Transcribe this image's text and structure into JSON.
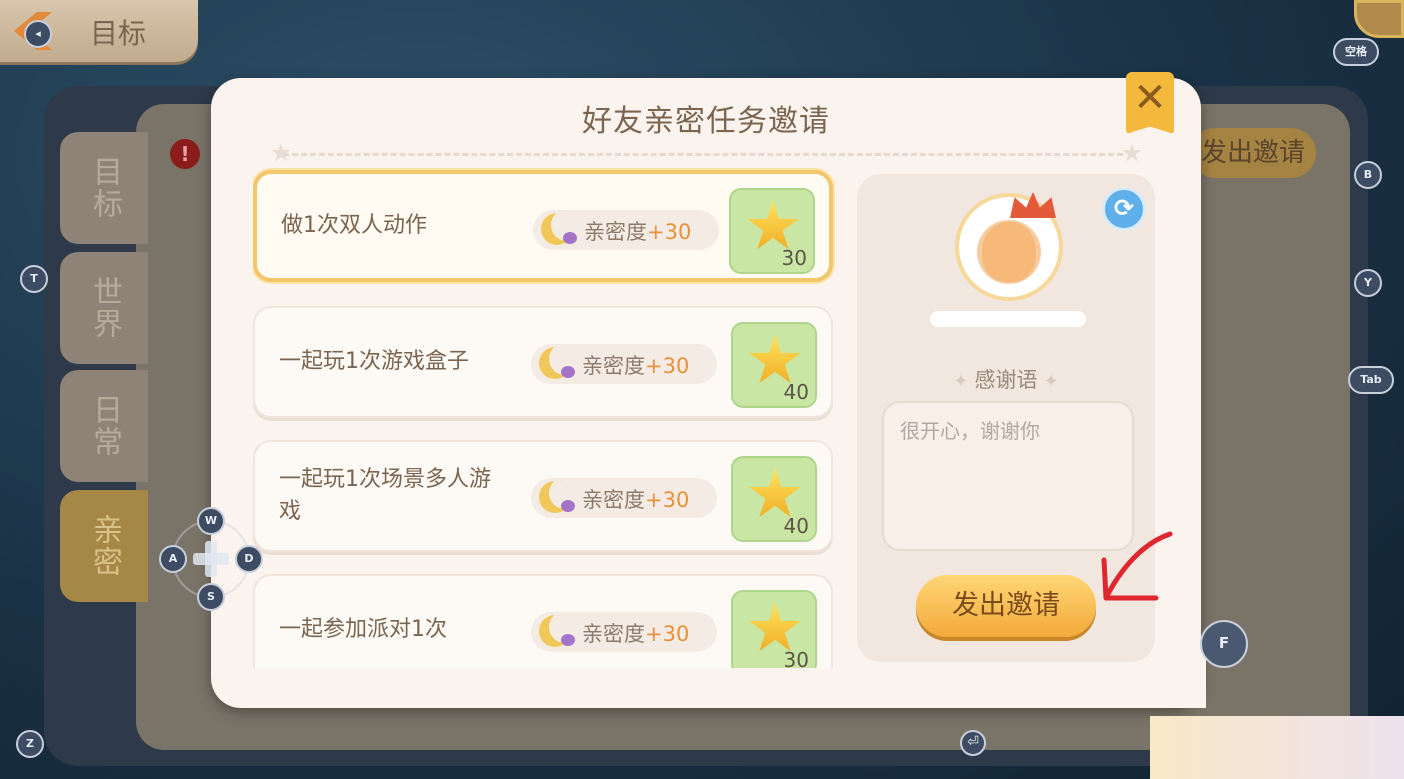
{
  "top_bar": {
    "title": "目标"
  },
  "side_tabs": [
    {
      "label": "目标"
    },
    {
      "label": "世界"
    },
    {
      "label": "日常"
    },
    {
      "label": "亲密"
    }
  ],
  "background": {
    "invite_label": "发出邀请",
    "alert_icon": "exclamation-icon"
  },
  "dialog": {
    "title": "好友亲密任务邀请",
    "close_icon": "close-icon",
    "tasks": [
      {
        "name": "做1次双人动作",
        "intimacy_label": "亲密度",
        "intimacy_value": "+30",
        "reward_count": "30",
        "selected": true
      },
      {
        "name": "一起玩1次游戏盒子",
        "intimacy_label": "亲密度",
        "intimacy_value": "+30",
        "reward_count": "40",
        "selected": false
      },
      {
        "name": "一起玩1次场景多人游戏",
        "intimacy_label": "亲密度",
        "intimacy_value": "+30",
        "reward_count": "40",
        "selected": false
      },
      {
        "name": "一起参加派对1次",
        "intimacy_label": "亲密度",
        "intimacy_value": "+30",
        "reward_count": "30",
        "selected": false
      }
    ],
    "friend": {
      "refresh_icon": "refresh-icon",
      "thanks_label": "感谢语",
      "thanks_value": "很开心，谢谢你",
      "send_button": "发出邀请"
    }
  },
  "key_hints": {
    "space": "空格",
    "b": "B",
    "y": "Y",
    "tab": "Tab",
    "t": "T",
    "w": "W",
    "a": "A",
    "s": "S",
    "d": "D",
    "f": "F",
    "z": "Z",
    "enter": "⏎"
  },
  "colors": {
    "accent": "#f2a93b",
    "dialog_bg": "#fbf4ee",
    "text": "#7b6550",
    "annotation": "#e0262e"
  }
}
